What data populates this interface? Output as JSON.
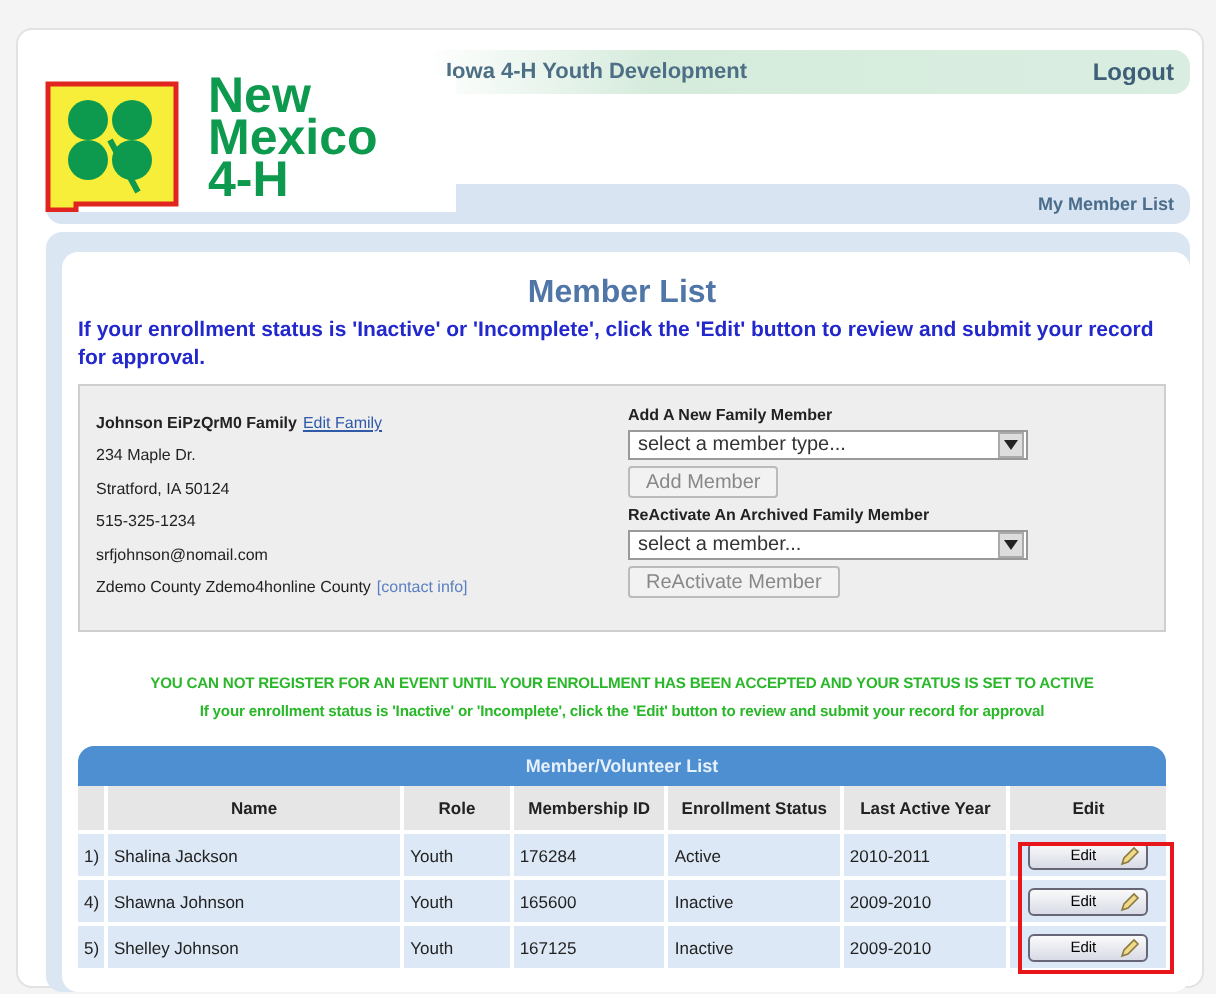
{
  "header": {
    "title": "Iowa 4-H Youth Development",
    "logout": "Logout"
  },
  "logo": {
    "text": [
      "New",
      "Mexico",
      "4-H"
    ]
  },
  "nav": {
    "link": "My Member List"
  },
  "page": {
    "title": "Member List",
    "notice": "If your enrollment status is 'Inactive' or 'Incomplete', click the 'Edit' button to review and submit your record for approval."
  },
  "family": {
    "name": "Johnson EiPzQrM0 Family",
    "edit_link": "Edit Family",
    "lines": [
      "234 Maple Dr.",
      "Stratford, IA 50124",
      "515-325-1234",
      "srfjohnson@nomail.com"
    ],
    "county": "Zdemo County Zdemo4honline County",
    "contact_link": "[contact info]"
  },
  "add_member": {
    "label": "Add A New Family Member",
    "placeholder": "select a member type...",
    "button": "Add Member"
  },
  "reactivate": {
    "label": "ReActivate An Archived Family Member",
    "placeholder": "select a member...",
    "button": "ReActivate Member"
  },
  "warnings": [
    "YOU CAN NOT REGISTER FOR AN EVENT UNTIL YOUR ENROLLMENT HAS BEEN ACCEPTED AND YOUR STATUS IS SET TO ACTIVE",
    "If your enrollment status is 'Inactive' or 'Incomplete', click the 'Edit' button to review and submit your record for approval"
  ],
  "table": {
    "title": "Member/Volunteer List",
    "columns": [
      "Name",
      "Role",
      "Membership ID",
      "Enrollment Status",
      "Last Active Year",
      "Edit"
    ],
    "edit_column_highlighted": true,
    "rows": [
      {
        "number": "1)",
        "name": "Shalina Jackson",
        "role": "Youth",
        "id": "176284",
        "status": "Active",
        "year": "2010-2011",
        "edit": "Edit"
      },
      {
        "number": "4)",
        "name": "Shawna Johnson",
        "role": "Youth",
        "id": "165600",
        "status": "Inactive",
        "year": "2009-2010",
        "edit": "Edit"
      },
      {
        "number": "5)",
        "name": "Shelley Johnson",
        "role": "Youth",
        "id": "167125",
        "status": "Inactive",
        "year": "2009-2010",
        "edit": "Edit"
      }
    ]
  }
}
